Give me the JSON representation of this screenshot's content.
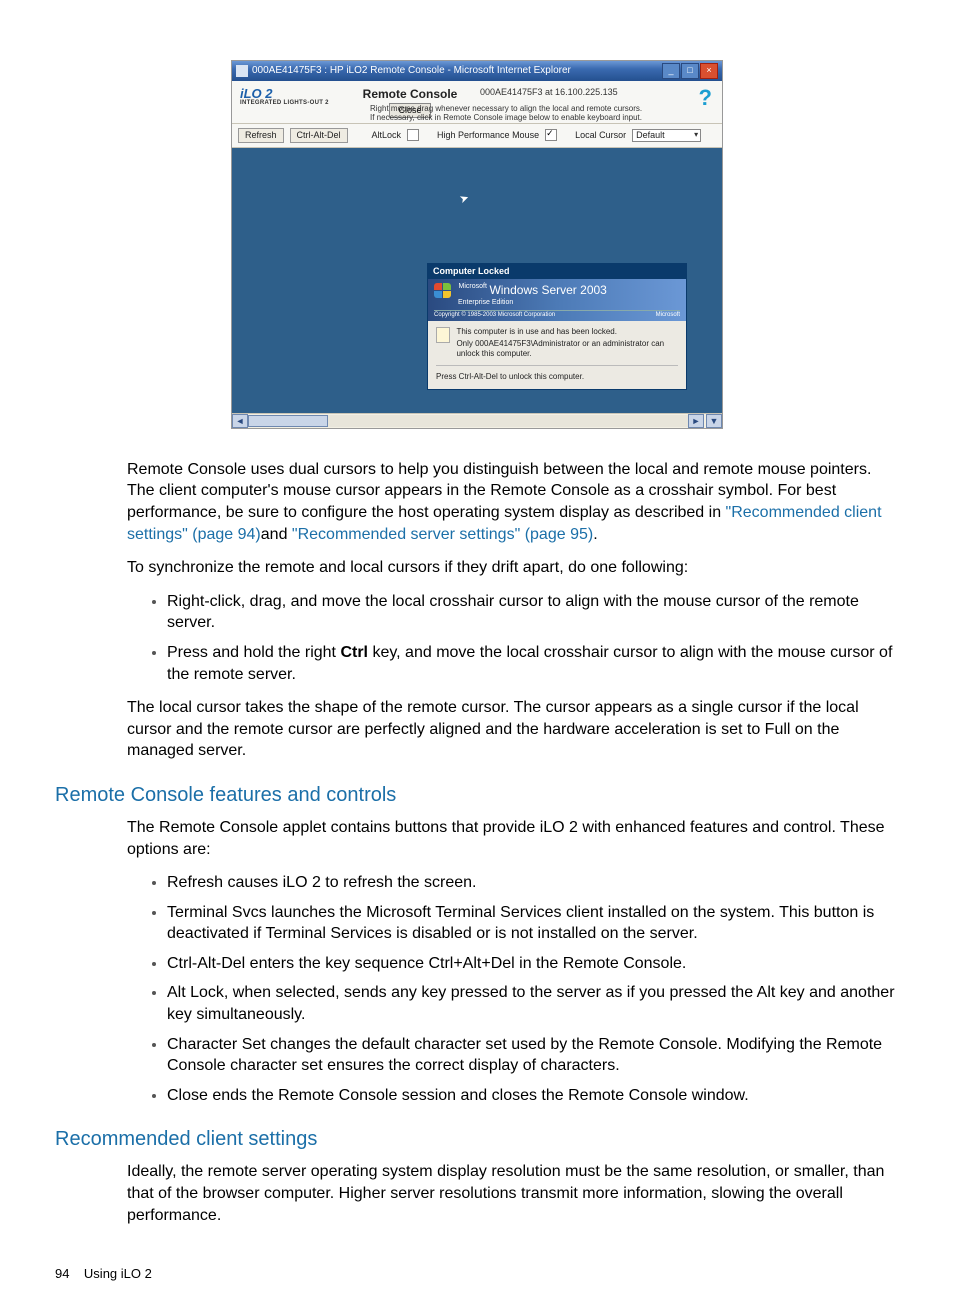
{
  "screenshot": {
    "titlebar_text": "000AE41475F3 : HP iLO2 Remote Console - Microsoft Internet Explorer",
    "ilo_brand": "iLO 2",
    "ilo_sub": "INTEGRATED LIGHTS-OUT 2",
    "panel_title": "Remote Console",
    "close_label": "Close",
    "server_id": "000AE41475F3 at 16.100.225.135",
    "hint1": "Right mouse drag whenever necessary to align the local and remote cursors.",
    "hint2": "If necessary, click in Remote Console image below to enable keyboard input.",
    "toolbar": {
      "refresh": "Refresh",
      "ctrlaltdel": "Ctrl-Alt-Del",
      "altlock": "AltLock",
      "hpmouse": "High Performance Mouse",
      "localcursor": "Local Cursor",
      "cursor_value": "Default"
    },
    "locked": {
      "header": "Computer Locked",
      "os_prefix": "Microsoft",
      "os_name": "Windows Server",
      "os_year": "2003",
      "os_edition": "Enterprise Edition",
      "copyright": "Copyright © 1985-2003 Microsoft Corporation",
      "ms": "Microsoft",
      "msg1": "This computer is in use and has been locked.",
      "msg2": "Only 000AE41475F3\\Administrator or an administrator can unlock this computer.",
      "msg3": "Press Ctrl-Alt-Del to unlock this computer."
    }
  },
  "para1_a": "Remote Console uses dual cursors to help you distinguish between the local and remote mouse pointers. The client computer's mouse cursor appears in the Remote Console as a crosshair symbol. For best performance, be sure to configure the host operating system display as described in ",
  "link1": "\"Recommended client settings\" (page 94)",
  "para1_b": "and ",
  "link2": "\"Recommended server settings\" (page 95)",
  "para1_c": ".",
  "para2": "To synchronize the remote and local cursors if they drift apart, do one following:",
  "sync_bullets": [
    "Right-click, drag, and move the local crosshair cursor to align with the mouse cursor of the remote server.",
    {
      "pre": "Press and hold the right ",
      "bold": "Ctrl",
      "post": " key, and move the local crosshair cursor to align with the mouse cursor of the remote server."
    }
  ],
  "para3": "The local cursor takes the shape of the remote cursor. The cursor appears as a single cursor if the local cursor and the remote cursor are perfectly aligned and the hardware acceleration is set to Full on the managed server.",
  "heading_features": "Remote Console features and controls",
  "para4": "The Remote Console applet contains buttons that provide iLO 2 with enhanced features and control. These options are:",
  "feature_bullets": [
    "Refresh causes iLO 2 to refresh the screen.",
    "Terminal Svcs launches the Microsoft Terminal Services client installed on the system. This button is deactivated if Terminal Services is disabled or is not installed on the server.",
    "Ctrl-Alt-Del enters the key sequence Ctrl+Alt+Del in the Remote Console.",
    "Alt Lock, when selected, sends any key pressed to the server as if you pressed the Alt key and another key simultaneously.",
    "Character Set changes the default character set used by the Remote Console. Modifying the Remote Console character set ensures the correct display of characters.",
    "Close ends the Remote Console session and closes the Remote Console window."
  ],
  "heading_client": "Recommended client settings",
  "para5": "Ideally, the remote server operating system display resolution must be the same resolution, or smaller, than that of the browser computer. Higher server resolutions transmit more information, slowing the overall performance.",
  "footer_page": "94",
  "footer_label": "Using iLO 2"
}
